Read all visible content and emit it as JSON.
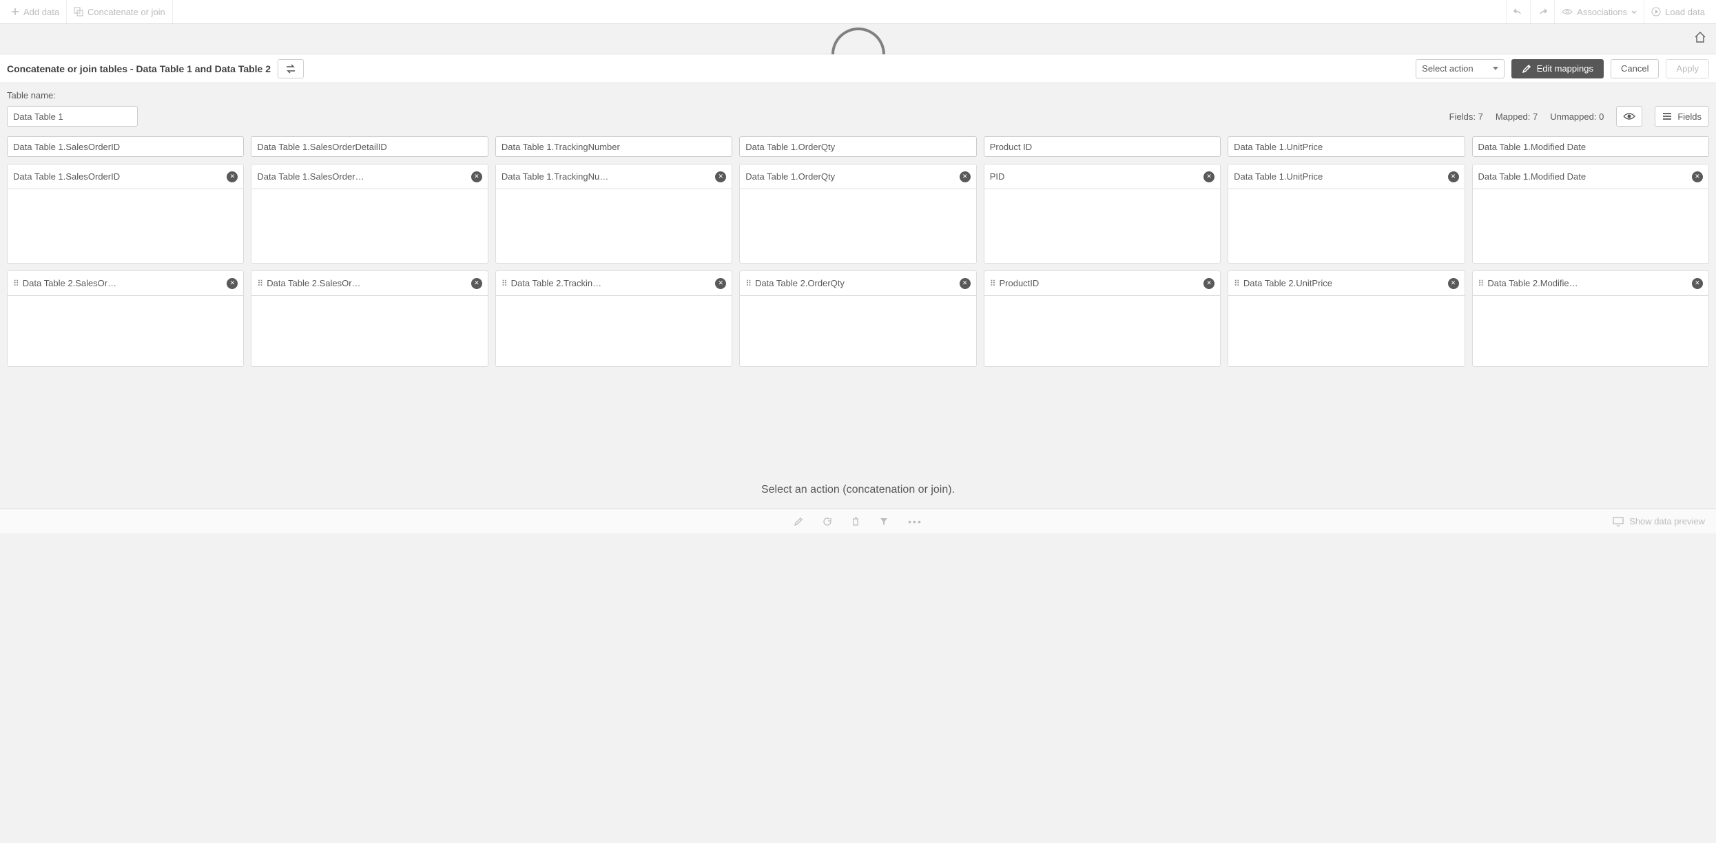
{
  "toolbar": {
    "add_data": "Add data",
    "concat_join": "Concatenate or join",
    "associations": "Associations",
    "load_data": "Load data"
  },
  "header": {
    "title": "Concatenate or join tables - Data Table 1 and Data Table 2",
    "select_action": "Select action",
    "edit_mappings": "Edit mappings",
    "cancel": "Cancel",
    "apply": "Apply"
  },
  "table_name": {
    "label": "Table name:",
    "value": "Data Table 1"
  },
  "stats": {
    "fields": "Fields: 7",
    "mapped": "Mapped: 7",
    "unmapped": "Unmapped: 0",
    "fields_btn": "Fields"
  },
  "columns": [
    {
      "header": "Data Table 1.SalesOrderID",
      "r1": "Data Table 1.SalesOrderID",
      "r2": "Data Table 2.SalesOr…"
    },
    {
      "header": "Data Table 1.SalesOrderDetailID",
      "r1": "Data Table 1.SalesOrder…",
      "r2": "Data Table 2.SalesOr…"
    },
    {
      "header": "Data Table 1.TrackingNumber",
      "r1": "Data Table 1.TrackingNu…",
      "r2": "Data Table 2.Trackin…"
    },
    {
      "header": "Data Table 1.OrderQty",
      "r1": "Data Table 1.OrderQty",
      "r2": "Data Table 2.OrderQty"
    },
    {
      "header": "Product ID",
      "r1": "PID",
      "r2": "ProductID"
    },
    {
      "header": "Data Table 1.UnitPrice",
      "r1": "Data Table 1.UnitPrice",
      "r2": "Data Table 2.UnitPrice"
    },
    {
      "header": "Data Table 1.Modified Date",
      "r1": "Data Table 1.Modified Date",
      "r2": "Data Table 2.Modifie…"
    }
  ],
  "footer_msg": "Select an action (concatenation or join).",
  "preview": "Show data preview"
}
